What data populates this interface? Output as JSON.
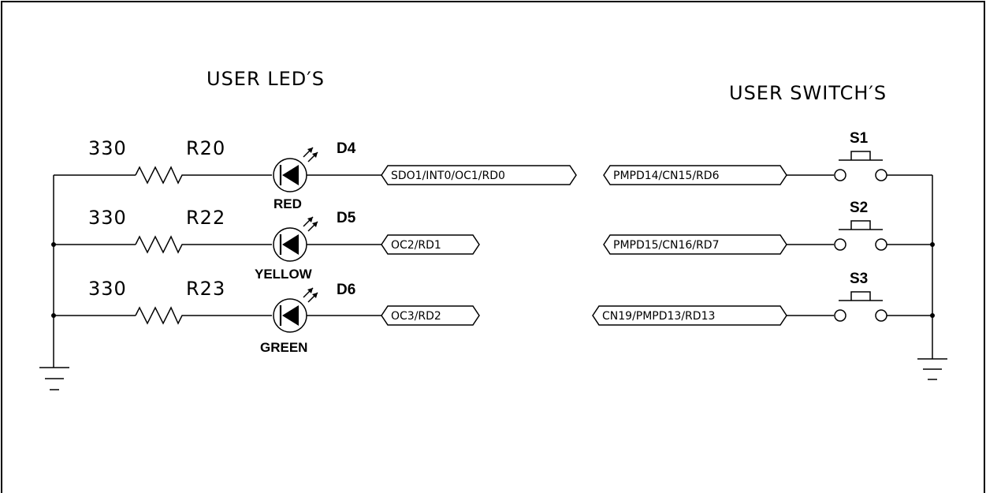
{
  "titles": {
    "leds": "USER LED′S",
    "switches": "USER SWITCH′S"
  },
  "leds": [
    {
      "resistor_value": "330",
      "resistor_ref": "R20",
      "diode_ref": "D4",
      "color": "RED",
      "net": "SDO1/INT0/OC1/RD0"
    },
    {
      "resistor_value": "330",
      "resistor_ref": "R22",
      "diode_ref": "D5",
      "color": "YELLOW",
      "net": "OC2/RD1"
    },
    {
      "resistor_value": "330",
      "resistor_ref": "R23",
      "diode_ref": "D6",
      "color": "GREEN",
      "net": "OC3/RD2"
    }
  ],
  "switches": [
    {
      "ref": "S1",
      "net": "PMPD14/CN15/RD6"
    },
    {
      "ref": "S2",
      "net": "PMPD15/CN16/RD7"
    },
    {
      "ref": "S3",
      "net": "CN19/PMPD13/RD13"
    }
  ]
}
